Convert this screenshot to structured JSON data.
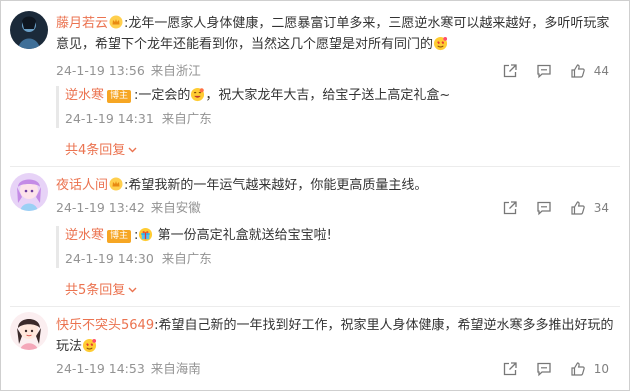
{
  "comments": [
    {
      "username": "藤月若云",
      "text": ":龙年一愿家人身体健康，二愿暴富订单多来，三愿逆水寒可以越来越好，多听听玩家意见，希望下个龙年还能看到你，当然这几个愿望是对所有同门的",
      "date": "24-1-19 13:56",
      "location": "来自浙江",
      "likes": "44",
      "reply": {
        "username": "逆水寒",
        "badge": "博主",
        "text": ":一定会的",
        "text2": "，祝大家龙年大吉，给宝子送上高定礼盒~",
        "date": "24-1-19 14:31",
        "location": "来自广东"
      },
      "more_replies": "共4条回复"
    },
    {
      "username": "夜话人间",
      "text": ":希望我新的一年运气越来越好，你能更高质量主线。",
      "date": "24-1-19 13:42",
      "location": "来自安徽",
      "likes": "34",
      "reply": {
        "username": "逆水寒",
        "badge": "博主",
        "text": ":",
        "text2": "第一份高定礼盒就送给宝宝啦!",
        "date": "24-1-19 14:30",
        "location": "来自广东"
      },
      "more_replies": "共5条回复"
    },
    {
      "username": "快乐不突头5649",
      "text": ":希望自己新的一年找到好工作，祝家里人身体健康，希望逆水寒多多推出好玩的玩法",
      "date": "24-1-19 14:53",
      "location": "来自海南",
      "likes": "10"
    }
  ],
  "colors": {
    "username": "#eb7350",
    "meta": "#939393",
    "badge": "#f6a623"
  }
}
